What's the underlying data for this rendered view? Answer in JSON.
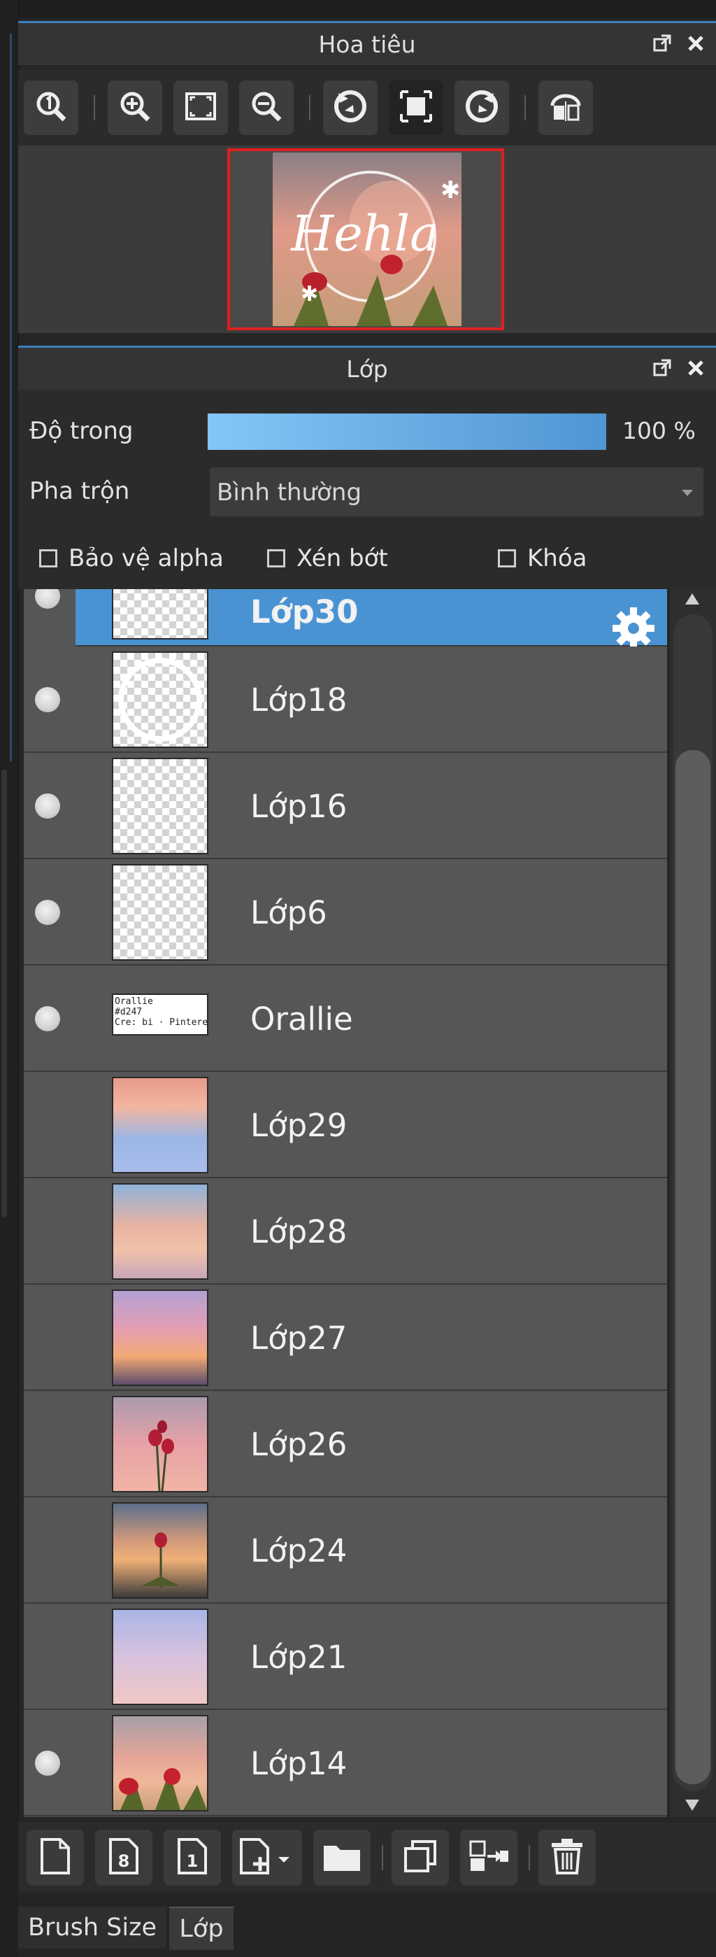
{
  "navigator": {
    "title": "Hoa tiêu",
    "thumbnail_text": "Hehla",
    "toolbar_icons": [
      "zoom-actual-icon",
      "zoom-in-icon",
      "fit-screen-icon",
      "zoom-out-icon",
      "rotate-left-icon",
      "fit-window-icon",
      "rotate-right-icon",
      "flip-horizontal-icon"
    ]
  },
  "layers_panel": {
    "title": "Lớp",
    "opacity_label": "Độ trong",
    "opacity_value": "100 %",
    "opacity_fraction": 1.0,
    "blend_label": "Pha trộn",
    "blend_value": "Bình thường",
    "protect_alpha_label": "Bảo vệ alpha",
    "clip_label": "Xén bớt",
    "lock_label": "Khóa"
  },
  "layers": [
    {
      "name": "Lớp30",
      "visible": true,
      "selected": true,
      "thumb": "blank"
    },
    {
      "name": "Lớp18",
      "visible": true,
      "selected": false,
      "thumb": "ring"
    },
    {
      "name": "Lớp16",
      "visible": true,
      "selected": false,
      "thumb": "blank"
    },
    {
      "name": "Lớp6",
      "visible": true,
      "selected": false,
      "thumb": "blank"
    },
    {
      "name": "Orallie",
      "visible": true,
      "selected": false,
      "thumb": "text"
    },
    {
      "name": "Lớp29",
      "visible": false,
      "selected": false,
      "thumb": "sky-blue"
    },
    {
      "name": "Lớp28",
      "visible": false,
      "selected": false,
      "thumb": "sky-peach"
    },
    {
      "name": "Lớp27",
      "visible": false,
      "selected": false,
      "thumb": "sky-sunset"
    },
    {
      "name": "Lớp26",
      "visible": false,
      "selected": false,
      "thumb": "sky-flower"
    },
    {
      "name": "Lớp24",
      "visible": false,
      "selected": false,
      "thumb": "sea-flower"
    },
    {
      "name": "Lớp21",
      "visible": false,
      "selected": false,
      "thumb": "sky-pale"
    },
    {
      "name": "Lớp14",
      "visible": true,
      "selected": false,
      "thumb": "tulips"
    }
  ],
  "orallie_thumb_text": [
    "Orallie",
    "#d247",
    "Cre: bi · Pinterest"
  ],
  "bottom_toolbar_icons": [
    "new-layer-icon",
    "new-8bit-layer-icon",
    "new-1bit-layer-icon",
    "add-layer-menu-icon",
    "new-folder-icon",
    "duplicate-layer-icon",
    "merge-down-icon",
    "delete-layer-icon"
  ],
  "tabs": [
    {
      "label": "Brush Size",
      "active": false
    },
    {
      "label": "Lớp",
      "active": true
    }
  ],
  "colors": {
    "accent": "#4a93d3",
    "nav_frame": "#e11e1e",
    "panel_border": "#3f7fbf"
  }
}
